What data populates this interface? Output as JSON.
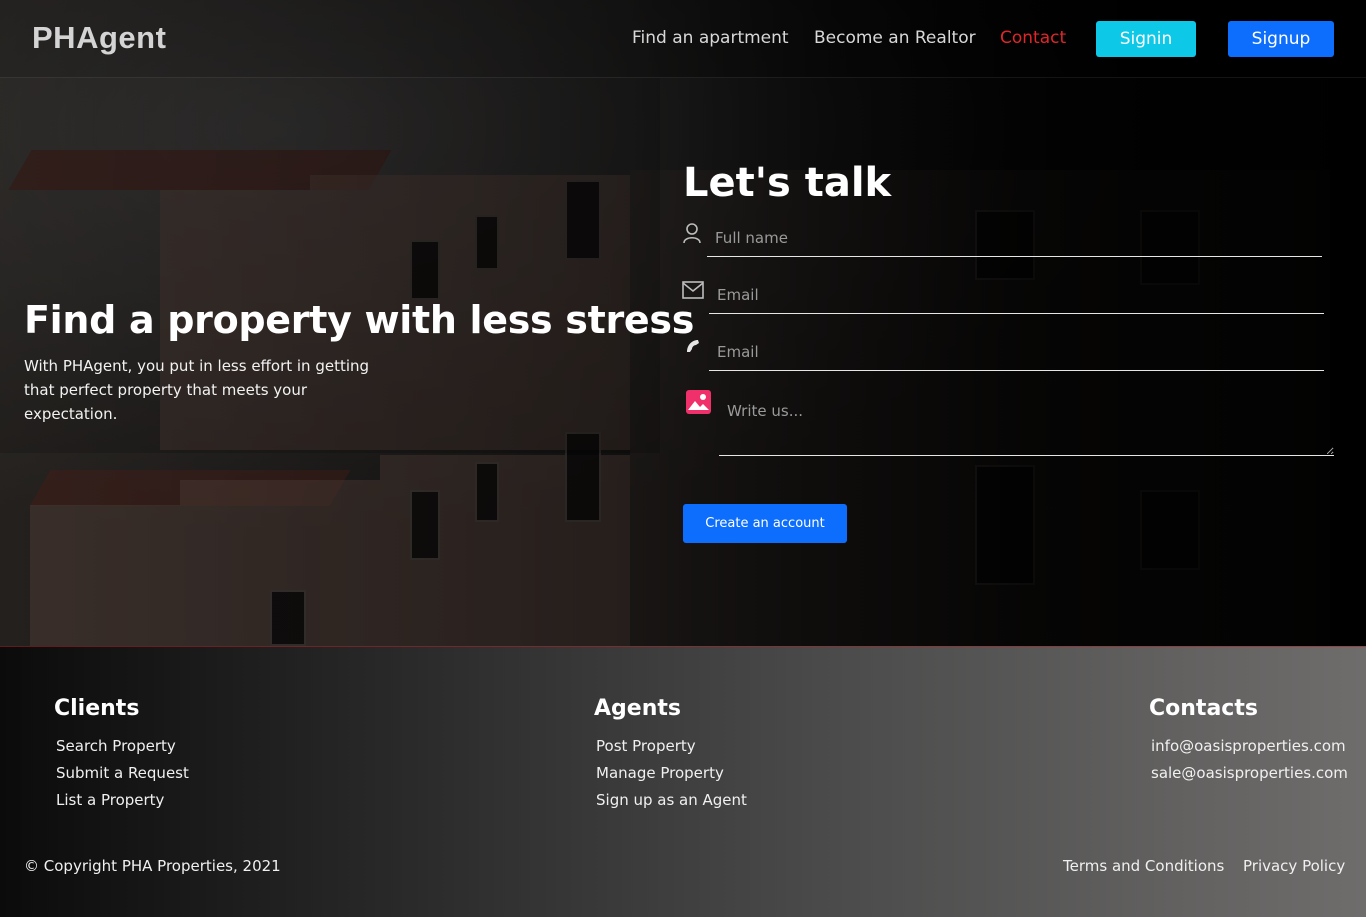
{
  "nav": {
    "brand": "PHAgent",
    "links": [
      "Find an apartment",
      "Become an Realtor",
      "Contact"
    ],
    "active_link": "Contact",
    "signin_label": "Signin",
    "signup_label": "Signup"
  },
  "hero": {
    "title": "Find a property with less stress",
    "subtitle": "With PHAgent, you put in less effort in getting that perfect property that meets your expectation."
  },
  "contact_form": {
    "title": "Let's talk",
    "fields": [
      {
        "icon": "user-icon",
        "placeholder": "Full name",
        "value": ""
      },
      {
        "icon": "envelope-icon",
        "placeholder": "Email",
        "value": ""
      },
      {
        "icon": "phone-icon",
        "placeholder": "Email",
        "value": ""
      },
      {
        "icon": "image-icon",
        "placeholder": "Write us...",
        "value": ""
      }
    ],
    "submit_label": "Create an account"
  },
  "footer": {
    "clients": {
      "title": "Clients",
      "links": [
        "Search Property",
        "Submit a Request",
        "List a Property"
      ]
    },
    "agents": {
      "title": "Agents",
      "links": [
        "Post Property",
        "Manage Property",
        "Sign up as an Agent"
      ]
    },
    "contacts": {
      "title": "Contacts",
      "links": [
        "info@oasisproperties.com",
        "sale@oasisproperties.com"
      ]
    },
    "copyright": "© Copyright PHA Properties, 2021",
    "legal_links": [
      "Terms and Conditions",
      "Privacy Policy"
    ]
  },
  "colors": {
    "primary": "#0d6efd",
    "signin": "#0ec8e8",
    "active_nav": "#e0262a",
    "image_icon": "#f0306a"
  }
}
